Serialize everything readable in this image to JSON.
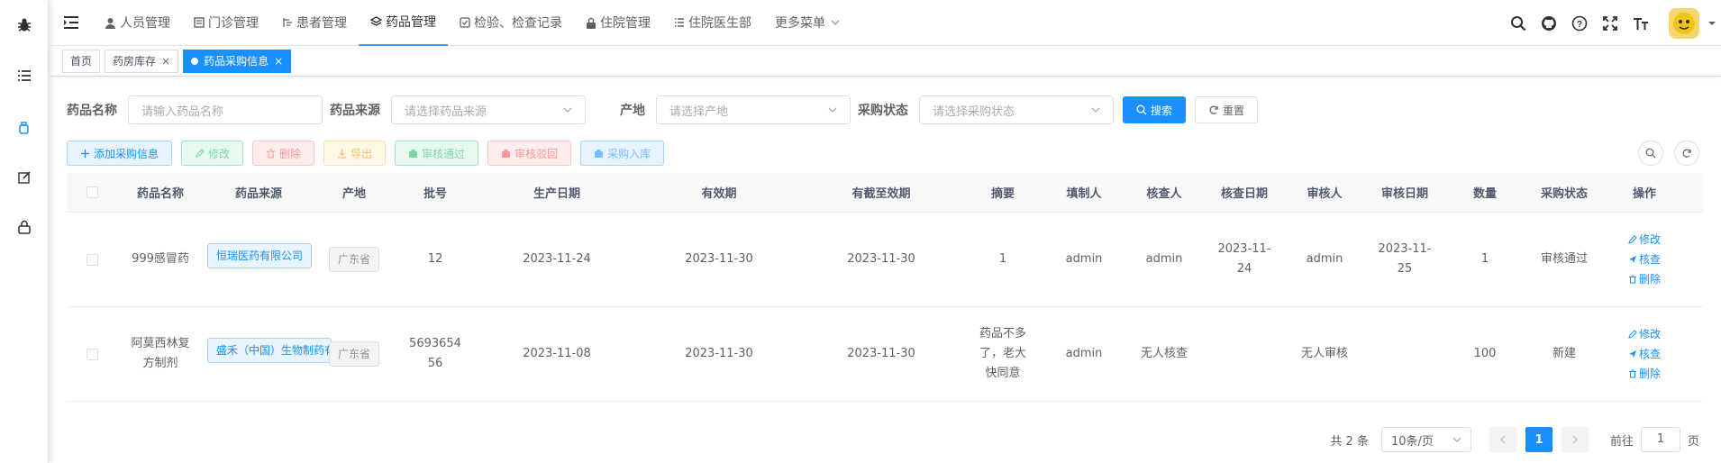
{
  "nav": {
    "menus": [
      {
        "label": "人员管理",
        "icon": "user-icon"
      },
      {
        "label": "门诊管理",
        "icon": "clinic-icon"
      },
      {
        "label": "患者管理",
        "icon": "patient-icon"
      },
      {
        "label": "药品管理",
        "icon": "drug-icon",
        "active": true
      },
      {
        "label": "检验、检查记录",
        "icon": "checklist-icon"
      },
      {
        "label": "住院管理",
        "icon": "lock-icon"
      },
      {
        "label": "住院医生部",
        "icon": "list-icon"
      }
    ],
    "more": "更多菜单"
  },
  "tags": [
    {
      "label": "首页",
      "closable": false
    },
    {
      "label": "药房库存",
      "closable": true
    },
    {
      "label": "药品采购信息",
      "closable": true,
      "active": true
    }
  ],
  "search": {
    "name_label": "药品名称",
    "name_placeholder": "请输入药品名称",
    "source_label": "药品来源",
    "source_placeholder": "请选择药品来源",
    "origin_label": "产地",
    "origin_placeholder": "请选择产地",
    "status_label": "采购状态",
    "status_placeholder": "请选择采购状态",
    "search_btn": "搜索",
    "reset_btn": "重置"
  },
  "toolbar": {
    "add": "添加采购信息",
    "edit": "修改",
    "delete": "删除",
    "export": "导出",
    "approve": "审核通过",
    "reject": "审核驳回",
    "stock_in": "采购入库"
  },
  "table": {
    "headers": [
      "药品名称",
      "药品来源",
      "产地",
      "批号",
      "生产日期",
      "有效期",
      "有截至效期",
      "摘要",
      "填制人",
      "核查人",
      "核查日期",
      "审核人",
      "审核日期",
      "数量",
      "采购状态",
      "操作"
    ],
    "rows": [
      {
        "name": "999感冒药",
        "source": "恒瑞医药有限公司",
        "origin": "广东省",
        "batch": "12",
        "prod_date": "2023-11-24",
        "valid": "2023-11-30",
        "expire": "2023-11-30",
        "summary": "1",
        "maker": "admin",
        "checker": "admin",
        "check_date": "2023-11-24",
        "auditor": "admin",
        "audit_date": "2023-11-25",
        "qty": "1",
        "status": "审核通过"
      },
      {
        "name": "阿莫西林复方制剂",
        "source": "盛禾（中国）生物制药有限公司",
        "origin": "广东省",
        "batch": "569365456",
        "prod_date": "2023-11-08",
        "valid": "2023-11-30",
        "expire": "2023-11-30",
        "summary": "药品不多了，老大快同意",
        "maker": "admin",
        "checker": "无人核查",
        "check_date": "",
        "auditor": "无人审核",
        "audit_date": "",
        "qty": "100",
        "status": "新建"
      }
    ],
    "ops": {
      "edit": "修改",
      "check": "核查",
      "delete": "删除"
    }
  },
  "pager": {
    "total": "共 2 条",
    "size": "10条/页",
    "current": "1",
    "goto": "前往",
    "goto_value": "1",
    "page_unit": "页"
  }
}
